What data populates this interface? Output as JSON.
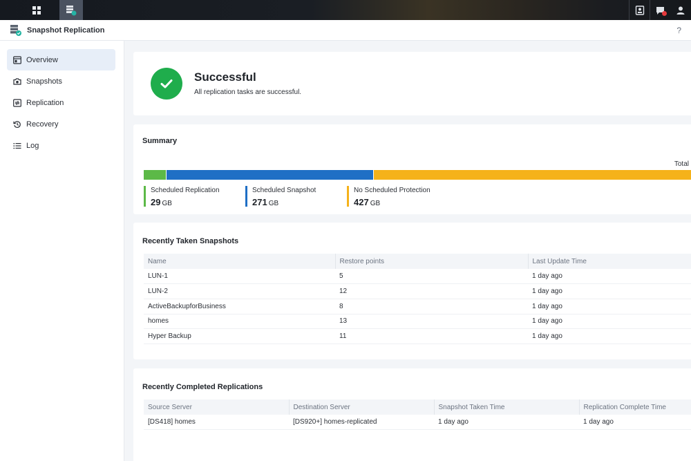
{
  "window": {
    "title": "Snapshot Replication",
    "help": "?"
  },
  "sidebar": {
    "items": [
      {
        "label": "Overview",
        "icon": "overview-icon"
      },
      {
        "label": "Snapshots",
        "icon": "camera-icon"
      },
      {
        "label": "Replication",
        "icon": "replication-icon"
      },
      {
        "label": "Recovery",
        "icon": "recovery-icon"
      },
      {
        "label": "Log",
        "icon": "list-icon"
      }
    ],
    "active": "Overview"
  },
  "status": {
    "title": "Successful",
    "subtitle": "All replication tasks are successful."
  },
  "summary": {
    "title": "Summary",
    "total_label": "Total",
    "segments": [
      {
        "name": "Scheduled Replication",
        "value": 29,
        "unit": "GB",
        "color": "#5cb947"
      },
      {
        "name": "Scheduled Snapshot",
        "value": 271,
        "unit": "GB",
        "color": "#1f6fc5"
      },
      {
        "name": "No Scheduled Protection",
        "value": 427,
        "unit": "GB",
        "color": "#f5b21a"
      }
    ]
  },
  "snapshots": {
    "title": "Recently Taken Snapshots",
    "columns": [
      "Name",
      "Restore points",
      "Last Update Time"
    ],
    "rows": [
      [
        "LUN-1",
        "5",
        "1 day ago"
      ],
      [
        "LUN-2",
        "12",
        "1 day ago"
      ],
      [
        "ActiveBackupforBusiness",
        "8",
        "1 day ago"
      ],
      [
        "homes",
        "13",
        "1 day ago"
      ],
      [
        "Hyper Backup",
        "11",
        "1 day ago"
      ]
    ]
  },
  "replications": {
    "title": "Recently Completed Replications",
    "columns": [
      "Source Server",
      "Destination Server",
      "Snapshot Taken Time",
      "Replication Complete Time"
    ],
    "rows": [
      [
        "[DS418] homes",
        "[DS920+] homes-replicated",
        "1 day ago",
        "1 day ago"
      ]
    ]
  }
}
